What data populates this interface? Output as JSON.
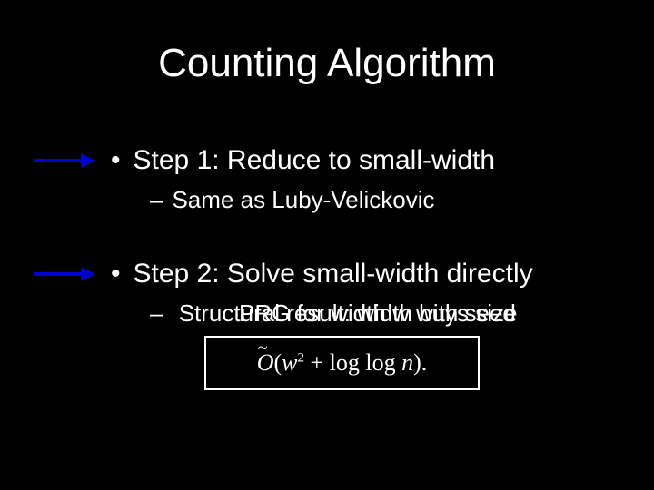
{
  "title": "Counting Algorithm",
  "steps": [
    {
      "bullet": "•",
      "label": "Step 1: Reduce to small-width",
      "sub_dash": "–",
      "sub_label": "Same as Luby-Velickovic"
    },
    {
      "bullet": "•",
      "label": "Step 2: Solve small-width directly",
      "overlap_a_prefix": "–",
      "overlap_a": "Structural result: width buys size",
      "overlap_b": "PRG for width w with seed"
    }
  ],
  "formula": {
    "tilde": "~",
    "O": "O",
    "open": "(",
    "w": "w",
    "exp": "2",
    "plus": " + ",
    "loglog": "log log",
    "space": " ",
    "n": "n",
    "close": ").",
    "display": "Õ(w² + log log n)."
  }
}
